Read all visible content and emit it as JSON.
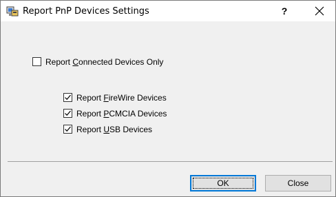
{
  "window": {
    "title": "Report PnP Devices Settings",
    "help_label": "?",
    "icon": "pnp-devices-app-icon",
    "close_icon": "close-icon"
  },
  "options": {
    "connected_only": {
      "before": "Report ",
      "accel": "C",
      "after": "onnected Devices Only",
      "checked": false
    },
    "firewire": {
      "before": "Report ",
      "accel": "F",
      "after": "ireWire Devices",
      "checked": true
    },
    "pcmcia": {
      "before": "Report ",
      "accel": "P",
      "after": "CMCIA Devices",
      "checked": true
    },
    "usb": {
      "before": "Report ",
      "accel": "U",
      "after": "SB Devices",
      "checked": true
    }
  },
  "buttons": {
    "ok_label": "OK",
    "close_label": "Close"
  },
  "colors": {
    "dialog_bg": "#f0f0f0",
    "default_button_border": "#0078d7"
  }
}
